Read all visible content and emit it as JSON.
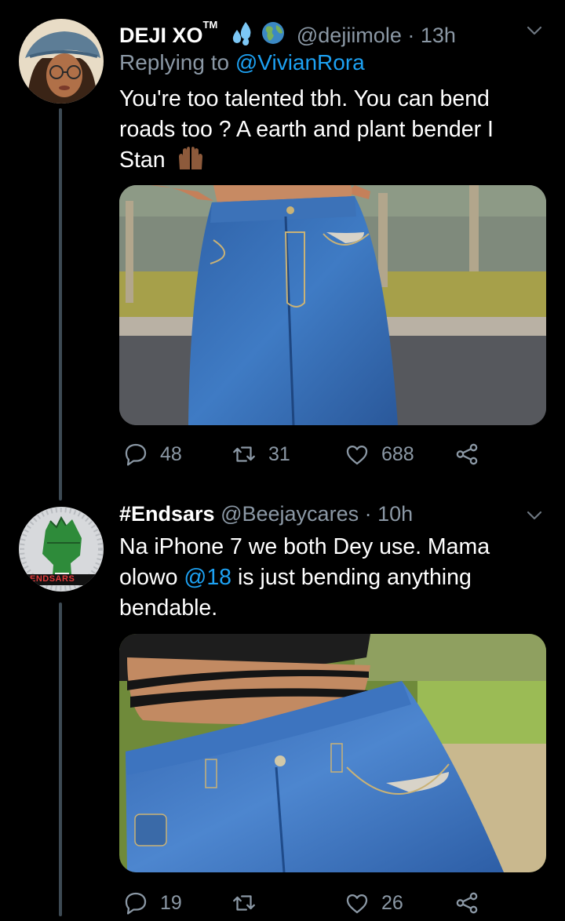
{
  "tweets": [
    {
      "display_name": "DEJI XO",
      "tm": "TM",
      "emojis": [
        "sweat-droplets-emoji",
        "globe-emoji"
      ],
      "handle": "@dejiimole",
      "separator": "·",
      "time": "13h",
      "replying_prefix": "Replying to",
      "replying_to": "@VivianRora",
      "text_lines": [
        "You're too talented tbh. You can bend",
        "roads too ? A earth and plant bender I",
        "Stan"
      ],
      "text_emoji": "raised-hands-emoji",
      "replies": "48",
      "retweets": "31",
      "likes": "688"
    },
    {
      "display_name": "#Endsars",
      "handle": "@Beejaycares",
      "separator": "·",
      "time": "10h",
      "text_line1": "Na iPhone 7 we both Dey use. Mama",
      "text_line2_pre": "olowo",
      "mention": "@18",
      "text_line2_post": "is just bending anything",
      "text_line3": "bendable.",
      "avatar_badge": "ENDSARS",
      "replies": "19",
      "likes": "26"
    }
  ],
  "colors": {
    "background": "#000000",
    "secondary_text": "#8b98a5",
    "link": "#1da1f2",
    "thread_line": "#3d4a54"
  }
}
